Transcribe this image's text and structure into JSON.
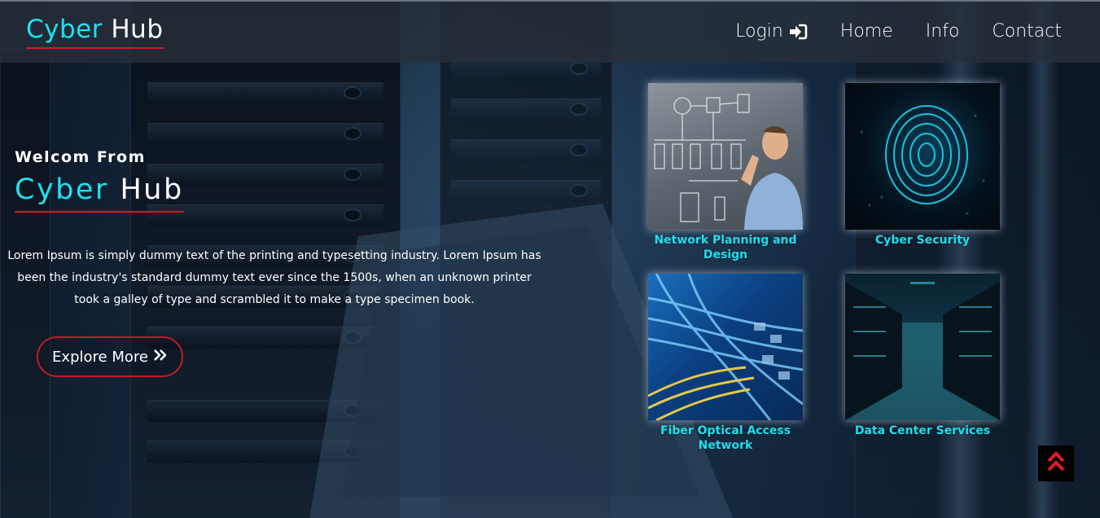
{
  "header": {
    "brand": {
      "part1": "Cyber",
      "part2": "Hub"
    },
    "nav": [
      {
        "label": "Login",
        "icon": "sign-in-icon"
      },
      {
        "label": "Home"
      },
      {
        "label": "Info"
      },
      {
        "label": "Contact"
      }
    ]
  },
  "hero": {
    "welcome": "Welcom From",
    "brand": {
      "part1": "Cyber",
      "part2": "Hub"
    },
    "description": "Lorem Ipsum is simply dummy text of the printing and typesetting industry. Lorem Ipsum has been the industry's standard dummy text ever since the 1500s, when an unknown printer took a galley of type and scrambled it to make a type specimen book.",
    "cta": {
      "label": "Explore More",
      "icon": "double-chevron-right-icon"
    }
  },
  "services": [
    {
      "label": "Network Planning and Design"
    },
    {
      "label": "Cyber Security"
    },
    {
      "label": "Fiber Optical Access Network"
    },
    {
      "label": "Data Center Services"
    }
  ],
  "scroll_top": {
    "icon": "double-chevron-up-icon"
  },
  "colors": {
    "accent_cyan": "#1ee0f0",
    "accent_red": "#d21a2a",
    "header_bg": "#28303a"
  }
}
